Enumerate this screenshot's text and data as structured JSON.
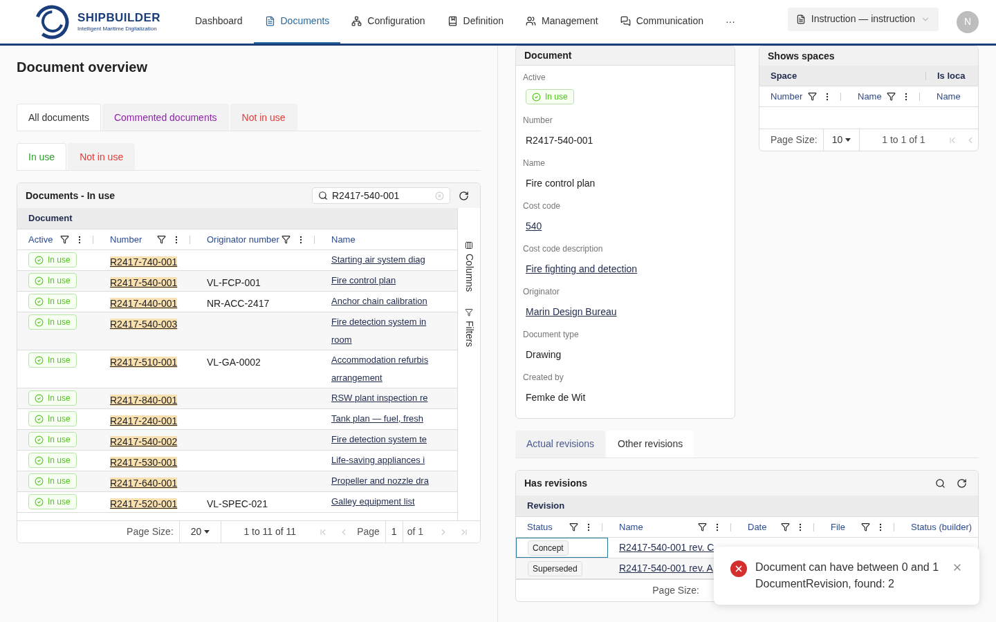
{
  "header": {
    "brand": "SHIPBUILDER",
    "tagline": "Intelligent Maritime Digitalization",
    "nav": [
      {
        "label": "Dashboard",
        "kind": "none",
        "selected": false
      },
      {
        "label": "Documents",
        "kind": "document",
        "selected": true
      },
      {
        "label": "Configuration",
        "kind": "network",
        "selected": false
      },
      {
        "label": "Definition",
        "kind": "book",
        "selected": false
      },
      {
        "label": "Management",
        "kind": "users",
        "selected": false
      },
      {
        "label": "Communication",
        "kind": "chat",
        "selected": false
      }
    ],
    "more": "···",
    "context": "Instruction — instruction",
    "avatar": "N"
  },
  "overview": {
    "title": "Document overview",
    "tabs": [
      {
        "label": "All documents",
        "selected": true,
        "color": "#333333"
      },
      {
        "label": "Commented documents",
        "selected": false,
        "color": "#8e24aa"
      },
      {
        "label": "Not in use",
        "selected": false,
        "color": "#e53935"
      }
    ],
    "subtabs": [
      {
        "label": "In use",
        "selected": true,
        "color": "#2e9d2e"
      },
      {
        "label": "Not in use",
        "selected": false,
        "color": "#e53935"
      }
    ],
    "table": {
      "title": "Documents - In use",
      "search": "R2417-540-001",
      "group": "Document",
      "columns": [
        "Active",
        "Number",
        "Originator number",
        "Name"
      ],
      "rows": [
        {
          "active": "In use",
          "number": "R2417-740-001",
          "originator": "",
          "name": [
            "Starting air system diag"
          ]
        },
        {
          "active": "In use",
          "number": "R2417-540-001",
          "originator": "VL-FCP-001",
          "name": [
            "Fire control plan"
          ]
        },
        {
          "active": "In use",
          "number": "R2417-440-001",
          "originator": "NR-ACC-2417",
          "name": [
            "Anchor chain calibration"
          ]
        },
        {
          "active": "In use",
          "number": "R2417-540-003",
          "originator": "",
          "name": [
            "Fire detection system in",
            "room"
          ]
        },
        {
          "active": "In use",
          "number": "R2417-510-001",
          "originator": "VL-GA-0002",
          "name": [
            "Accommodation refurbis",
            "arrangement"
          ]
        },
        {
          "active": "In use",
          "number": "R2417-840-001",
          "originator": "",
          "name": [
            "RSW plant inspection re"
          ]
        },
        {
          "active": "In use",
          "number": "R2417-240-001",
          "originator": "",
          "name": [
            "Tank plan — fuel, fresh"
          ]
        },
        {
          "active": "In use",
          "number": "R2417-540-002",
          "originator": "",
          "name": [
            "Fire detection system te"
          ]
        },
        {
          "active": "In use",
          "number": "R2417-530-001",
          "originator": "",
          "name": [
            "Life-saving appliances i"
          ]
        },
        {
          "active": "In use",
          "number": "R2417-640-001",
          "originator": "",
          "name": [
            "Propeller and nozzle dra"
          ]
        },
        {
          "active": "In use",
          "number": "R2417-520-001",
          "originator": "VL-SPEC-021",
          "name": [
            "Galley equipment list"
          ]
        }
      ],
      "side": [
        "Columns",
        "Filters"
      ],
      "pagination": {
        "size_label": "Page Size:",
        "size": "20",
        "range": "1 to 11 of 11",
        "page_label": "Page",
        "page": "1",
        "of": "of 1"
      }
    }
  },
  "detail": {
    "title": "Document",
    "fields": [
      {
        "label": "Active",
        "value": "In use",
        "kind": "badge"
      },
      {
        "label": "Number",
        "value": "R2417-540-001",
        "kind": "text"
      },
      {
        "label": "Name",
        "value": "Fire control plan",
        "kind": "text"
      },
      {
        "label": "Cost code",
        "value": "540",
        "kind": "link"
      },
      {
        "label": "Cost code description",
        "value": "Fire fighting and detection",
        "kind": "link"
      },
      {
        "label": "Originator",
        "value": "Marin Design Bureau",
        "kind": "link"
      },
      {
        "label": "Document type",
        "value": "Drawing",
        "kind": "text"
      },
      {
        "label": "Created by",
        "value": "Femke de Wit",
        "kind": "text"
      }
    ]
  },
  "spaces": {
    "title": "Shows spaces",
    "groups": [
      "Space",
      "Is loca"
    ],
    "columns": [
      "Number",
      "Name",
      "Name"
    ],
    "pagination": {
      "size_label": "Page Size:",
      "size": "10",
      "range": "1 to 1 of 1"
    }
  },
  "revision_tabs": [
    {
      "label": "Actual revisions",
      "selected": false
    },
    {
      "label": "Other revisions",
      "selected": true
    }
  ],
  "revisions": {
    "title": "Has revisions",
    "group": "Revision",
    "columns": [
      "Status",
      "Name",
      "Date",
      "File",
      "Status (builder)"
    ],
    "rows": [
      {
        "status": "Concept",
        "name": "R2417-540-001 rev. C",
        "selected": true
      },
      {
        "status": "Superseded",
        "name": "R2417-540-001 rev. A",
        "selected": false
      }
    ],
    "size_label": "Page Size:"
  },
  "toast": {
    "message": "Document can have between 0 and 1 DocumentRevision, found: 2"
  }
}
